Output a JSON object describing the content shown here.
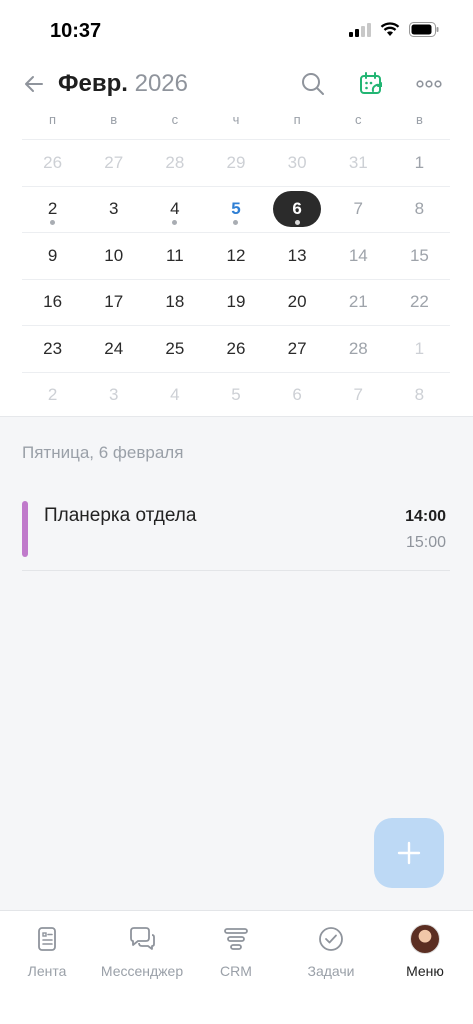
{
  "status_bar": {
    "time": "10:37"
  },
  "header": {
    "month": "Февр.",
    "year": "2026"
  },
  "calendar": {
    "weekdays": [
      "п",
      "в",
      "с",
      "ч",
      "п",
      "с",
      "в"
    ],
    "weeks": [
      [
        "26",
        "27",
        "28",
        "29",
        "30",
        "31",
        "1"
      ],
      [
        "2",
        "3",
        "4",
        "5",
        "6",
        "7",
        "8"
      ],
      [
        "9",
        "10",
        "11",
        "12",
        "13",
        "14",
        "15"
      ],
      [
        "16",
        "17",
        "18",
        "19",
        "20",
        "21",
        "22"
      ],
      [
        "23",
        "24",
        "25",
        "26",
        "27",
        "28",
        "1"
      ],
      [
        "2",
        "3",
        "4",
        "5",
        "6",
        "7",
        "8"
      ]
    ]
  },
  "agenda": {
    "day_heading": "Пятница, 6 февраля",
    "events": [
      {
        "title": "Планерка отдела",
        "start": "14:00",
        "end": "15:00",
        "color": "#c07acb"
      }
    ]
  },
  "bottom_nav": {
    "items": [
      {
        "label": "Лента",
        "icon": "feed-icon"
      },
      {
        "label": "Мессенджер",
        "icon": "messenger-icon"
      },
      {
        "label": "CRM",
        "icon": "crm-icon"
      },
      {
        "label": "Задачи",
        "icon": "tasks-icon"
      },
      {
        "label": "Меню",
        "icon": "avatar"
      }
    ]
  },
  "colors": {
    "accent_blue": "#2f7fd4",
    "calendar_green": "#22b573",
    "event_purple": "#c07acb",
    "fab": "#bdd9f5"
  }
}
